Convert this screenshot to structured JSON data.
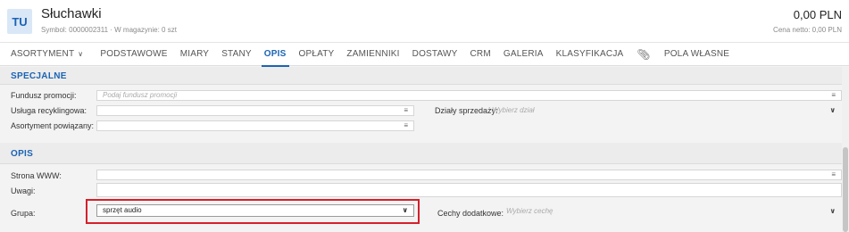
{
  "header": {
    "avatar_text": "TU",
    "title": "Słuchawki",
    "subtitle": "Symbol: 0000002311 · W magazynie: 0 szt",
    "price": "0,00 PLN",
    "price_sub": "Cena netto: 0,00 PLN"
  },
  "tabs": {
    "assortment": "ASORTYMENT",
    "items": [
      "PODSTAWOWE",
      "MIARY",
      "STANY",
      "OPIS",
      "OPŁATY",
      "ZAMIENNIKI",
      "DOSTAWY",
      "CRM",
      "GALERIA",
      "KLASYFIKACJA"
    ],
    "active": "OPIS",
    "custom_fields": "POLA WŁASNE"
  },
  "special": {
    "title": "SPECJALNE",
    "fundusz_label": "Fundusz promocji:",
    "fundusz_placeholder": "Podaj fundusz promocji",
    "usluga_label": "Usługa recyklingowa:",
    "dzialy_label": "Działy sprzedaży:",
    "dzialy_placeholder": "Wybierz dział",
    "asortyment_label": "Asortyment powiązany:"
  },
  "opis": {
    "title": "OPIS",
    "www_label": "Strona WWW:",
    "uwagi_label": "Uwagi:",
    "grupa_label": "Grupa:",
    "grupa_value": "sprzęt audio",
    "cechy_label": "Cechy dodatkowe:",
    "cechy_placeholder": "Wybierz cechę"
  },
  "colors": {
    "accent": "#1b63b5",
    "highlight": "#d4202a"
  }
}
